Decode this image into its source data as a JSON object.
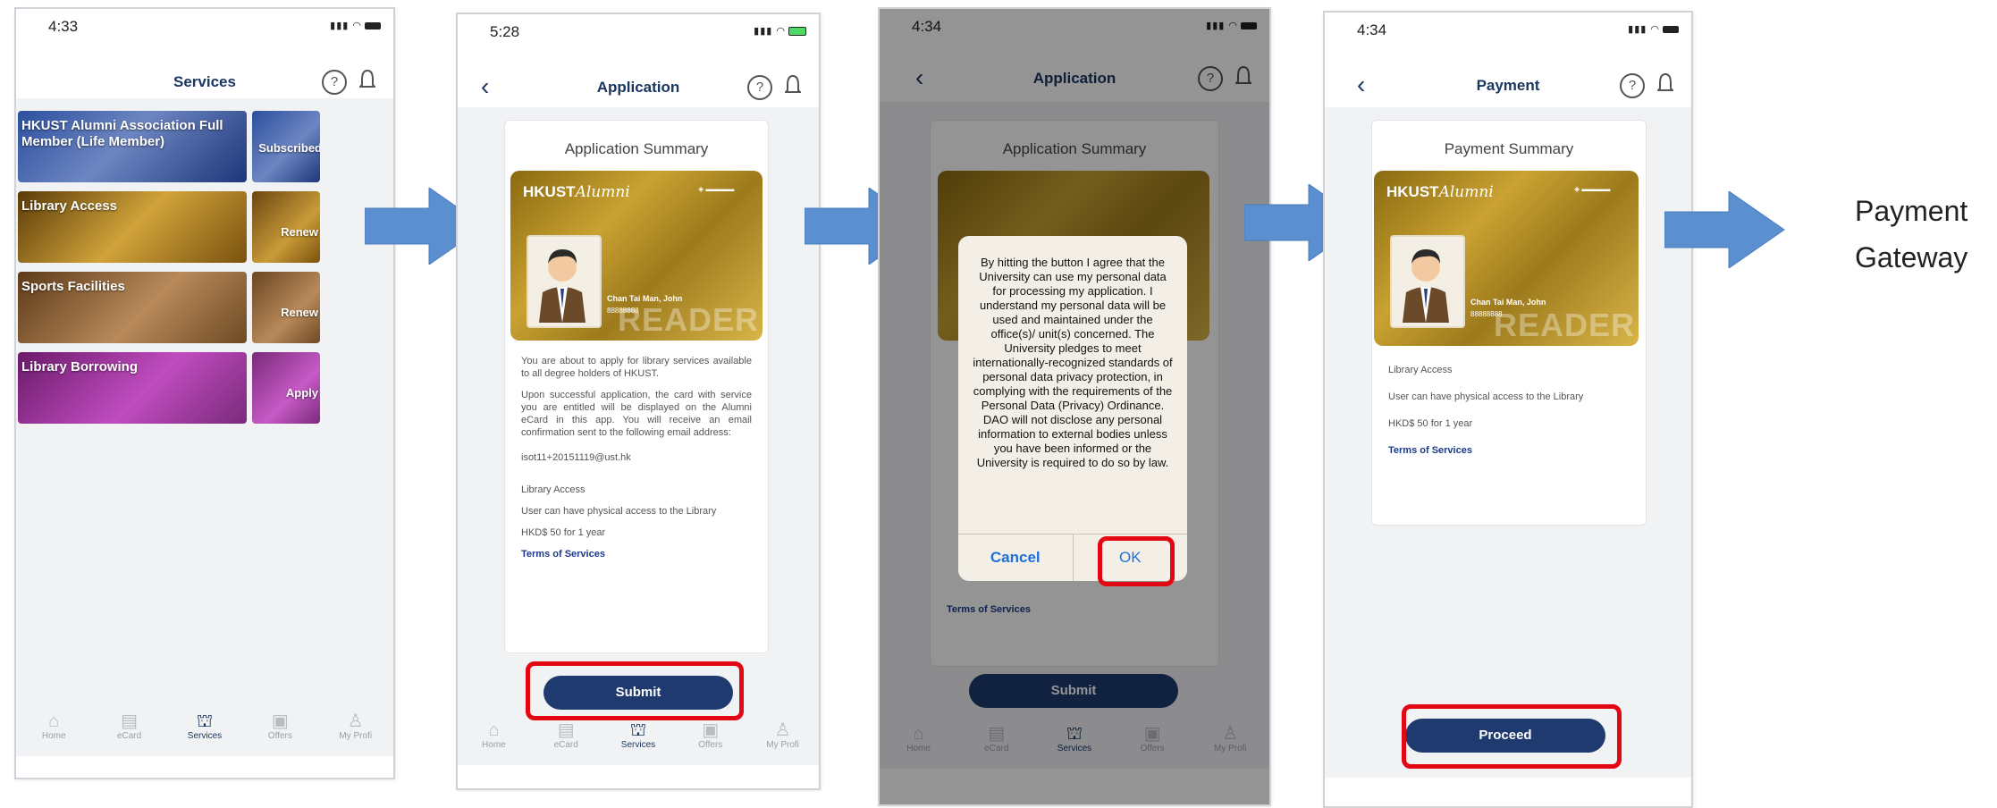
{
  "screens": {
    "services": {
      "time": "4:33",
      "title": "Services",
      "tiles": [
        {
          "label": "HKUST Alumni Association Full Member (Life Member)",
          "status": "Subscribed"
        },
        {
          "label": "Library Access",
          "status": "Renew"
        },
        {
          "label": "Sports Facilities",
          "status": "Renew"
        },
        {
          "label": "Library Borrowing",
          "status": "Apply"
        }
      ]
    },
    "application": {
      "time": "5:28",
      "title": "Application",
      "summary_title": "Application Summary",
      "card_brand": "HKUST",
      "card_brand_italic": "Alumni",
      "card_name": "Chan Tai Man, John",
      "card_number": "88888888",
      "card_watermark": "READER",
      "para1": "You are about to apply for library services available to all degree holders of HKUST.",
      "para2": "Upon successful application, the card with service you are entitled will be displayed on the Alumni eCard in this app. You will receive an email confirmation sent to the following email address:",
      "email": "isot11+20151119@ust.hk",
      "service_name": "Library Access",
      "service_desc": "User can have physical access to the Library",
      "price": "HKD$ 50 for 1 year",
      "terms": "Terms of Services",
      "submit": "Submit"
    },
    "confirm": {
      "time": "4:34",
      "title": "Application",
      "summary_title": "Application Summary",
      "dialog_text": "By hitting the button I agree that the University can use my personal data for processing my application. I understand my personal data will be used and maintained under the office(s)/ unit(s) concerned. The University pledges to meet internationally-recognized standards of personal data privacy protection, in complying with the requirements of the Personal Data (Privacy) Ordinance. DAO will not disclose any personal information to external bodies unless you have been informed or the University is required to do so by law.",
      "cancel": "Cancel",
      "ok": "OK",
      "terms": "Terms of Services",
      "submit": "Submit"
    },
    "payment": {
      "time": "4:34",
      "title": "Payment",
      "summary_title": "Payment Summary",
      "service_name": "Library Access",
      "service_desc": "User can have physical access to the Library",
      "price": "HKD$ 50 for 1 year",
      "terms": "Terms of Services",
      "proceed": "Proceed"
    }
  },
  "tabs": [
    "Home",
    "eCard",
    "Services",
    "Offers",
    "My Profi"
  ],
  "gateway": {
    "line1": "Payment",
    "line2": "Gateway"
  },
  "colors": {
    "accent": "#1e3a6e",
    "highlight": "#e30613",
    "arrow": "#5b8fd0"
  }
}
